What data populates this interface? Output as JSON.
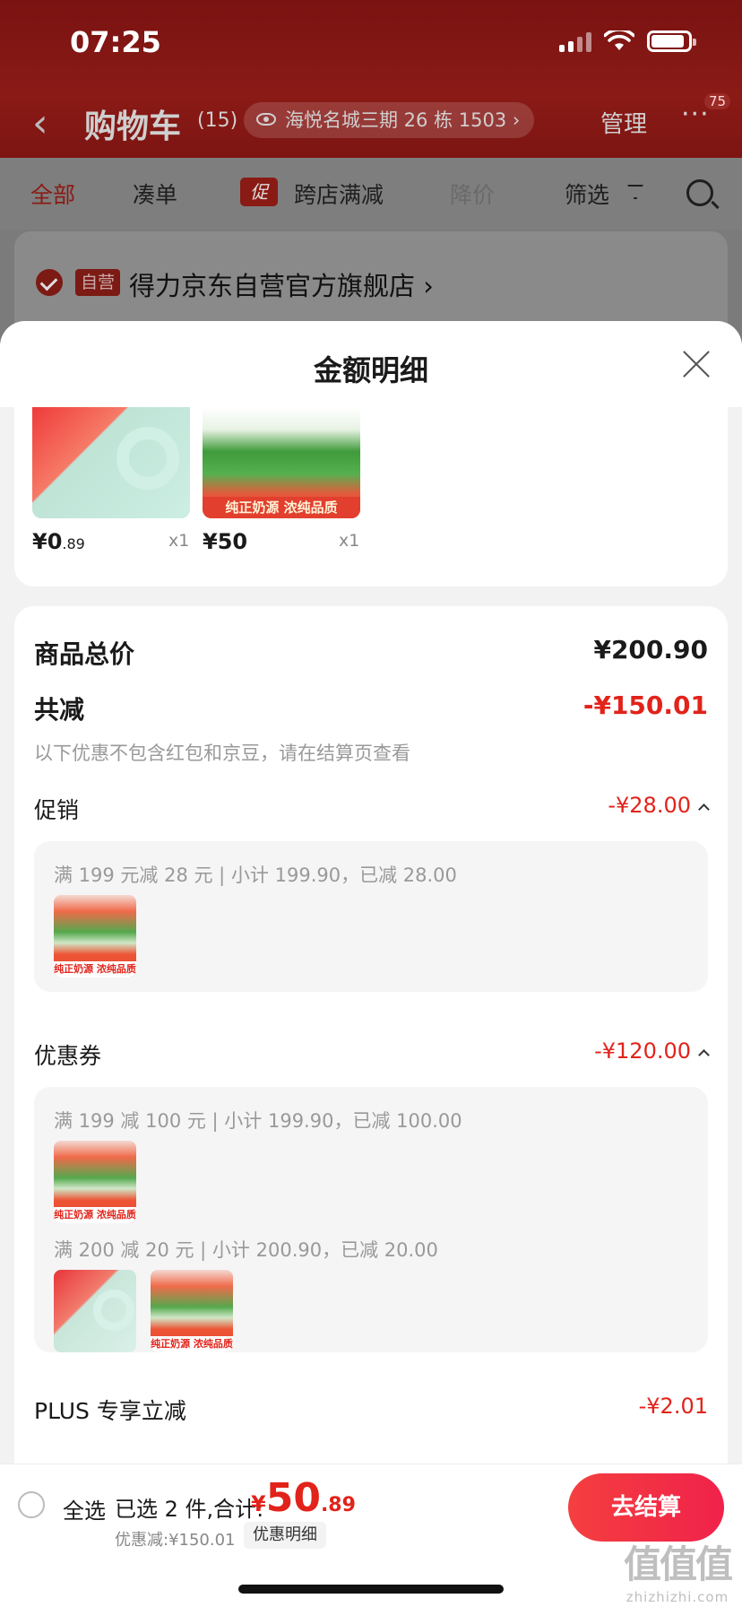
{
  "status_bar": {
    "time": "07:25"
  },
  "nav": {
    "back_icon": "chevron-left-icon",
    "title": "购物车",
    "count": "(15)",
    "address": "海悦名城三期 26 栋 1503",
    "address_chevron": "›",
    "manage": "管理",
    "more": "···",
    "more_badge": "75"
  },
  "tabs": {
    "all": "全部",
    "combine": "凑单",
    "promo_tag": "促",
    "cross_store": "跨店满减",
    "price_drop": "降价",
    "filter": "筛选"
  },
  "store": {
    "self_tag": "自营",
    "name": "得力京东自营官方旗舰店",
    "chevron": "›"
  },
  "sheet": {
    "title": "金额明细",
    "products": [
      {
        "image": "tape-product",
        "caption": "",
        "price_int": "¥0",
        "price_dec": ".89",
        "qty": "x1"
      },
      {
        "image": "milk-product",
        "caption": "纯正奶源 浓纯品质",
        "price_int": "¥50",
        "price_dec": "",
        "qty": "x1"
      }
    ],
    "goods_total_label": "商品总价",
    "goods_total_value": "¥200.90",
    "total_reduce_label": "共减",
    "total_reduce_value": "-¥150.01",
    "hint": "以下优惠不包含红包和京豆，请在结算页查看",
    "promotion": {
      "label": "促销",
      "value": "-¥28.00",
      "rule": "满 199 元减 28 元 | 小计 199.90，已减 28.00",
      "thumb_caption": "纯正奶源 浓纯品质"
    },
    "coupon": {
      "label": "优惠券",
      "value": "-¥120.00",
      "rule1": "满 199 减 100 元 | 小计 199.90，已减 100.00",
      "rule2": "满 200 减 20 元 | 小计 200.90，已减 20.00",
      "thumb_caption": "纯正奶源 浓纯品质"
    },
    "plus": {
      "label": "PLUS 专享立减",
      "value": "-¥2.01"
    }
  },
  "bottom_bar": {
    "select_all": "全选",
    "selected_summary": "已选 2 件,合计:",
    "total_currency": "¥",
    "total_int": "50",
    "total_dec": ".89",
    "discount": "优惠减:¥150.01",
    "detail_link": "优惠明细",
    "checkout": "去结算"
  },
  "watermark": {
    "big": "值值值",
    "small": "zhizhizhi.com"
  },
  "colors": {
    "accent_red": "#e2231a",
    "header_red": "#8a1a16",
    "checkout_red": "#f43f3f"
  }
}
